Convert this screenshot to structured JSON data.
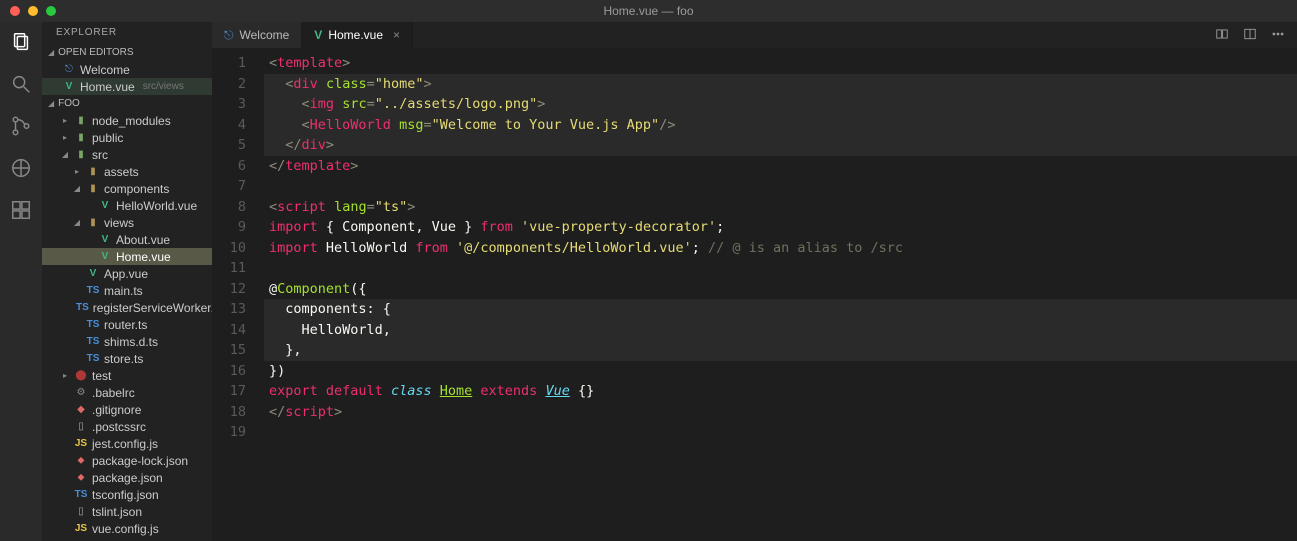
{
  "titlebar": {
    "title": "Home.vue — foo"
  },
  "sidebar": {
    "title": "EXPLORER",
    "sections": {
      "openEditors": "OPEN EDITORS",
      "project": "FOO"
    },
    "openEditors": [
      {
        "icon": "home",
        "label": "Welcome"
      },
      {
        "icon": "vue",
        "label": "Home.vue",
        "sub": "src/views",
        "selected": true
      }
    ],
    "tree": [
      {
        "d": 1,
        "t": "folder-c",
        "twist": "▸",
        "label": "node_modules",
        "ic": "folder"
      },
      {
        "d": 1,
        "t": "folder-c",
        "twist": "▸",
        "label": "public",
        "ic": "folder"
      },
      {
        "d": 1,
        "t": "folder-o",
        "twist": "◢",
        "label": "src",
        "ic": "folder"
      },
      {
        "d": 2,
        "t": "folder-c",
        "twist": "▸",
        "label": "assets",
        "ic": "folder2"
      },
      {
        "d": 2,
        "t": "folder-o",
        "twist": "◢",
        "label": "components",
        "ic": "folder2"
      },
      {
        "d": 3,
        "t": "file",
        "label": "HelloWorld.vue",
        "ic": "vue"
      },
      {
        "d": 2,
        "t": "folder-o",
        "twist": "◢",
        "label": "views",
        "ic": "folder2"
      },
      {
        "d": 3,
        "t": "file",
        "label": "About.vue",
        "ic": "vue"
      },
      {
        "d": 3,
        "t": "file",
        "label": "Home.vue",
        "ic": "vue",
        "selected": true
      },
      {
        "d": 2,
        "t": "file",
        "label": "App.vue",
        "ic": "vue"
      },
      {
        "d": 2,
        "t": "file",
        "label": "main.ts",
        "ic": "ts"
      },
      {
        "d": 2,
        "t": "file",
        "label": "registerServiceWorker.ts",
        "ic": "ts"
      },
      {
        "d": 2,
        "t": "file",
        "label": "router.ts",
        "ic": "ts"
      },
      {
        "d": 2,
        "t": "file",
        "label": "shims.d.ts",
        "ic": "ts"
      },
      {
        "d": 2,
        "t": "file",
        "label": "store.ts",
        "ic": "ts"
      },
      {
        "d": 1,
        "t": "folder-c",
        "twist": "▸",
        "label": "test",
        "ic": "bug"
      },
      {
        "d": 1,
        "t": "file",
        "label": ".babelrc",
        "ic": "gear"
      },
      {
        "d": 1,
        "t": "file",
        "label": ".gitignore",
        "ic": "git"
      },
      {
        "d": 1,
        "t": "file",
        "label": ".postcssrc",
        "ic": "file"
      },
      {
        "d": 1,
        "t": "file",
        "label": "jest.config.js",
        "ic": "js"
      },
      {
        "d": 1,
        "t": "file",
        "label": "package-lock.json",
        "ic": "json"
      },
      {
        "d": 1,
        "t": "file",
        "label": "package.json",
        "ic": "json"
      },
      {
        "d": 1,
        "t": "file",
        "label": "tsconfig.json",
        "ic": "ts"
      },
      {
        "d": 1,
        "t": "file",
        "label": "tslint.json",
        "ic": "file"
      },
      {
        "d": 1,
        "t": "file",
        "label": "vue.config.js",
        "ic": "js"
      }
    ]
  },
  "tabs": [
    {
      "icon": "home",
      "label": "Welcome",
      "active": false,
      "closable": false
    },
    {
      "icon": "vue",
      "label": "Home.vue",
      "active": true,
      "closable": true
    }
  ],
  "code": {
    "lines": [
      {
        "n": 1,
        "html": "<span class='g'>&lt;</span><span class='r'>template</span><span class='g'>&gt;</span>"
      },
      {
        "n": 2,
        "hl": true,
        "html": "  <span class='g'>&lt;</span><span class='r'>div</span> <span class='gr'>class</span><span class='g'>=</span><span class='y'>\"home\"</span><span class='g'>&gt;</span>"
      },
      {
        "n": 3,
        "hl": true,
        "html": "    <span class='g'>&lt;</span><span class='r'>img</span> <span class='gr'>src</span><span class='g'>=</span><span class='y'>\"../assets/logo.png\"</span><span class='g'>&gt;</span>"
      },
      {
        "n": 4,
        "hl": true,
        "html": "    <span class='g'>&lt;</span><span class='r'>HelloWorld</span> <span class='gr'>msg</span><span class='g'>=</span><span class='y'>\"Welcome to Your Vue.js App\"</span><span class='g'>/&gt;</span>"
      },
      {
        "n": 5,
        "hl": true,
        "html": "  <span class='g'>&lt;/</span><span class='r'>div</span><span class='g'>&gt;</span>"
      },
      {
        "n": 6,
        "html": "<span class='g'>&lt;/</span><span class='r'>template</span><span class='g'>&gt;</span>"
      },
      {
        "n": 7,
        "html": ""
      },
      {
        "n": 8,
        "html": "<span class='g'>&lt;</span><span class='r'>script</span> <span class='gr'>lang</span><span class='g'>=</span><span class='y'>\"ts\"</span><span class='g'>&gt;</span>"
      },
      {
        "n": 9,
        "html": "<span class='r'>import</span> <span class='w'>{ Component, Vue }</span> <span class='r'>from</span> <span class='y'>'vue-property-decorator'</span><span class='w'>;</span>"
      },
      {
        "n": 10,
        "html": "<span class='r'>import</span> <span class='w'>HelloWorld</span> <span class='r'>from</span> <span class='y'>'@/components/HelloWorld.vue'</span><span class='w'>;</span> <span class='cm'>// @ is an alias to /src</span>"
      },
      {
        "n": 11,
        "html": ""
      },
      {
        "n": 12,
        "html": "<span class='w'>@</span><span class='gr'>Component</span><span class='w'>({</span>"
      },
      {
        "n": 13,
        "hl": true,
        "html": "  <span class='w'>components: {</span>"
      },
      {
        "n": 14,
        "hl": true,
        "html": "    <span class='w'>HelloWorld,</span>"
      },
      {
        "n": 15,
        "hl": true,
        "html": "  <span class='w'>},</span>"
      },
      {
        "n": 16,
        "html": "<span class='w'>})</span>"
      },
      {
        "n": 17,
        "html": "<span class='r'>export</span> <span class='r'>default</span> <span class='c'>class</span> <span class='gr u'>Home</span> <span class='r'>extends</span> <span class='c u'>Vue</span> <span class='w'>{}</span>"
      },
      {
        "n": 18,
        "html": "<span class='g'>&lt;/</span><span class='r'>script</span><span class='g'>&gt;</span>"
      },
      {
        "n": 19,
        "html": ""
      }
    ]
  },
  "icons": {
    "vue": "V",
    "ts": "TS",
    "js": "JS",
    "json": "⬥",
    "folder": "▮",
    "folder2": "▮",
    "home": "⎋",
    "git": "◆",
    "gear": "⚙",
    "bug": "⬤",
    "file": "▯"
  }
}
